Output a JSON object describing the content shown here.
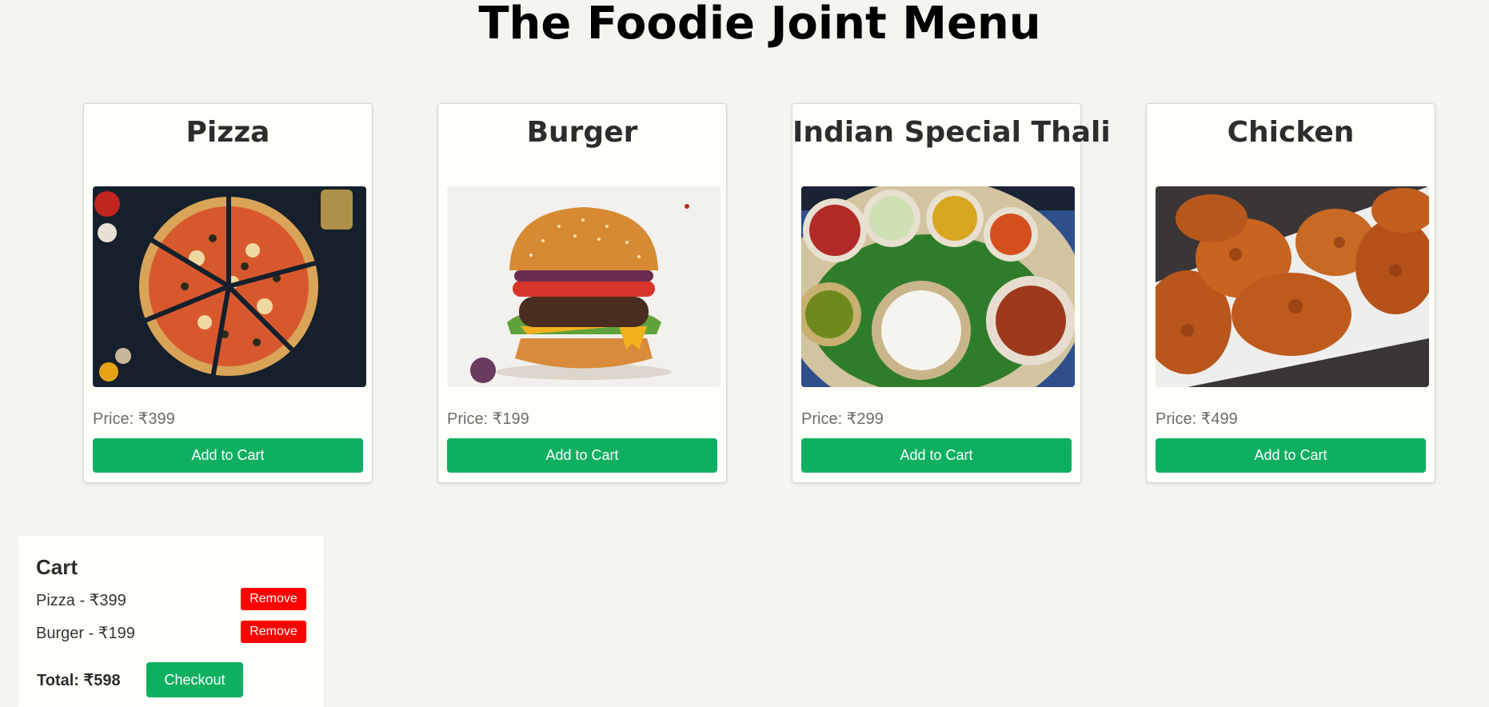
{
  "page": {
    "title": "The Foodie Joint Menu"
  },
  "menu": {
    "items": [
      {
        "name": "Pizza",
        "price": "Price: ₹399",
        "button": "Add to Cart",
        "image": "pizza-image"
      },
      {
        "name": "Burger",
        "price": "Price: ₹199",
        "button": "Add to Cart",
        "image": "burger-image"
      },
      {
        "name": "Indian Special Thali",
        "price": "Price: ₹299",
        "button": "Add to Cart",
        "image": "thali-image"
      },
      {
        "name": "Chicken",
        "price": "Price: ₹499",
        "button": "Add to Cart",
        "image": "fried-chicken-image"
      }
    ]
  },
  "cart": {
    "title": "Cart",
    "items": [
      {
        "text": "Pizza - ₹399",
        "remove": "Remove"
      },
      {
        "text": "Burger - ₹199",
        "remove": "Remove"
      }
    ],
    "total": "Total: ₹598",
    "checkout": "Checkout"
  },
  "colors": {
    "background": "#f4f4f1",
    "card": "#fffffa",
    "accent_green": "#0faf62",
    "remove_red": "#ff0000"
  }
}
